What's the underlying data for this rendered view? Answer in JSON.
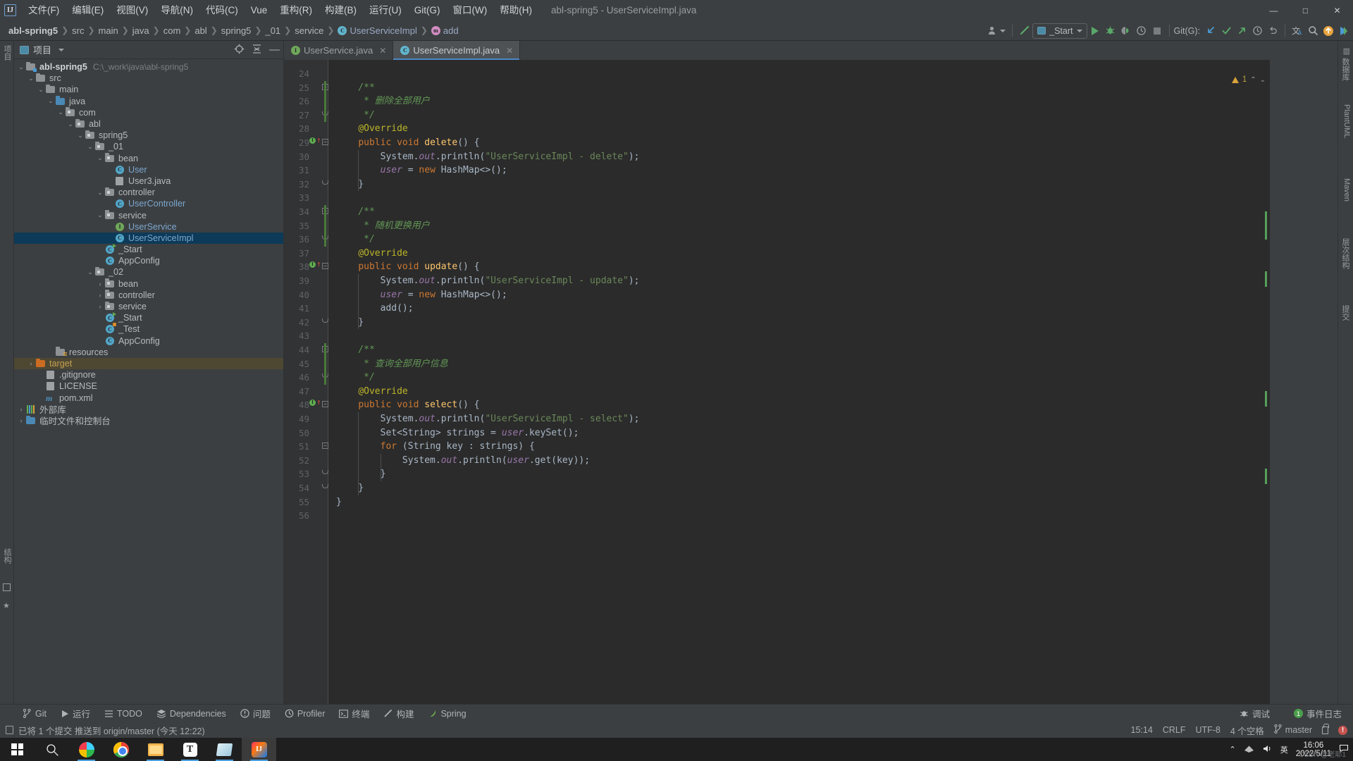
{
  "titlebar": {
    "logo": "IJ",
    "menus": [
      "文件(F)",
      "编辑(E)",
      "视图(V)",
      "导航(N)",
      "代码(C)",
      "Vue",
      "重构(R)",
      "构建(B)",
      "运行(U)",
      "Git(G)",
      "窗口(W)",
      "帮助(H)"
    ],
    "window_title": "abl-spring5 - UserServiceImpl.java",
    "minimize": "—",
    "maximize": "□",
    "close": "✕"
  },
  "navbar": {
    "breadcrumbs": [
      {
        "label": "abl-spring5",
        "style": "bold"
      },
      {
        "label": "src",
        "style": "plain"
      },
      {
        "label": "main",
        "style": "plain"
      },
      {
        "label": "java",
        "style": "plain"
      },
      {
        "label": "com",
        "style": "plain"
      },
      {
        "label": "abl",
        "style": "plain"
      },
      {
        "label": "spring5",
        "style": "plain"
      },
      {
        "label": "_01",
        "style": "plain"
      },
      {
        "label": "service",
        "style": "plain"
      },
      {
        "label": "UserServiceImpl",
        "style": "class"
      },
      {
        "label": "add",
        "style": "method"
      }
    ],
    "separator": "❯",
    "run_config": "_Start",
    "git_label": "Git(G):"
  },
  "left_strip": [
    "项目",
    "结构"
  ],
  "project_panel": {
    "title": "项目",
    "tree": [
      {
        "depth": 0,
        "arrow": "v",
        "icon": "folder-module",
        "label": "abl-spring5",
        "bold": true,
        "sub": "C:\\_work\\java\\abl-spring5"
      },
      {
        "depth": 1,
        "arrow": "v",
        "icon": "folder",
        "label": "src"
      },
      {
        "depth": 2,
        "arrow": "v",
        "icon": "folder",
        "label": "main"
      },
      {
        "depth": 3,
        "arrow": "v",
        "icon": "folder-source",
        "label": "java"
      },
      {
        "depth": 4,
        "arrow": "v",
        "icon": "package",
        "label": "com"
      },
      {
        "depth": 5,
        "arrow": "v",
        "icon": "package",
        "label": "abl"
      },
      {
        "depth": 6,
        "arrow": "v",
        "icon": "package",
        "label": "spring5"
      },
      {
        "depth": 7,
        "arrow": "v",
        "icon": "package",
        "label": "_01"
      },
      {
        "depth": 8,
        "arrow": "v",
        "icon": "package",
        "label": "bean"
      },
      {
        "depth": 9,
        "arrow": "",
        "icon": "class",
        "label": "User",
        "blue": true
      },
      {
        "depth": 9,
        "arrow": "",
        "icon": "file",
        "label": "User3.java"
      },
      {
        "depth": 8,
        "arrow": "v",
        "icon": "package",
        "label": "controller"
      },
      {
        "depth": 9,
        "arrow": "",
        "icon": "class",
        "label": "UserController",
        "blue": true
      },
      {
        "depth": 8,
        "arrow": "v",
        "icon": "package",
        "label": "service"
      },
      {
        "depth": 9,
        "arrow": "",
        "icon": "interface",
        "label": "UserService",
        "blue": true
      },
      {
        "depth": 9,
        "arrow": "",
        "icon": "class",
        "label": "UserServiceImpl",
        "blue": true,
        "selected": true
      },
      {
        "depth": 8,
        "arrow": "",
        "icon": "class-run",
        "label": "_Start"
      },
      {
        "depth": 8,
        "arrow": "",
        "icon": "class",
        "label": "AppConfig"
      },
      {
        "depth": 7,
        "arrow": "v",
        "icon": "package",
        "label": "_02"
      },
      {
        "depth": 8,
        "arrow": ">",
        "icon": "package",
        "label": "bean"
      },
      {
        "depth": 8,
        "arrow": ">",
        "icon": "package",
        "label": "controller"
      },
      {
        "depth": 8,
        "arrow": ">",
        "icon": "package",
        "label": "service"
      },
      {
        "depth": 8,
        "arrow": "",
        "icon": "class-run",
        "label": "_Start"
      },
      {
        "depth": 8,
        "arrow": "",
        "icon": "class-test",
        "label": "_Test"
      },
      {
        "depth": 8,
        "arrow": "",
        "icon": "class",
        "label": "AppConfig"
      },
      {
        "depth": 3,
        "arrow": "",
        "icon": "folder-resources",
        "label": "resources"
      },
      {
        "depth": 1,
        "arrow": ">",
        "icon": "folder-target",
        "label": "target",
        "orange": true,
        "highlight": true
      },
      {
        "depth": 2,
        "arrow": "",
        "icon": "gitignore",
        "label": ".gitignore"
      },
      {
        "depth": 2,
        "arrow": "",
        "icon": "file",
        "label": "LICENSE"
      },
      {
        "depth": 2,
        "arrow": "",
        "icon": "maven",
        "label": "pom.xml"
      },
      {
        "depth": 0,
        "arrow": ">",
        "icon": "library",
        "label": "外部库"
      },
      {
        "depth": 0,
        "arrow": ">",
        "icon": "scratch",
        "label": "临时文件和控制台"
      }
    ]
  },
  "editor": {
    "tabs": [
      {
        "label": "UserService.java",
        "icon": "interface",
        "active": false
      },
      {
        "label": "UserServiceImpl.java",
        "icon": "class",
        "active": true
      }
    ],
    "warning_count": "1",
    "first_line": 24,
    "lines": [
      {
        "n": 24,
        "tokens": []
      },
      {
        "n": 25,
        "fold": "start",
        "change": true,
        "tokens": [
          {
            "t": "    ",
            "c": "pln"
          },
          {
            "t": "/**",
            "c": "cmt"
          }
        ]
      },
      {
        "n": 26,
        "change": true,
        "tokens": [
          {
            "t": "     * ",
            "c": "cmt"
          },
          {
            "t": "删除全部用户",
            "c": "cmt"
          }
        ]
      },
      {
        "n": 27,
        "fold": "end",
        "change": true,
        "tokens": [
          {
            "t": "     */",
            "c": "cmt"
          }
        ]
      },
      {
        "n": 28,
        "tokens": [
          {
            "t": "    ",
            "c": "pln"
          },
          {
            "t": "@Override",
            "c": "ann"
          }
        ]
      },
      {
        "n": 29,
        "override": true,
        "fold": "start",
        "tokens": [
          {
            "t": "    ",
            "c": "pln"
          },
          {
            "t": "public",
            "c": "kw"
          },
          {
            "t": " ",
            "c": "pln"
          },
          {
            "t": "void",
            "c": "kw"
          },
          {
            "t": " ",
            "c": "pln"
          },
          {
            "t": "delete",
            "c": "mth"
          },
          {
            "t": "() {",
            "c": "pln"
          }
        ]
      },
      {
        "n": 30,
        "tokens": [
          {
            "t": "        System.",
            "c": "pln"
          },
          {
            "t": "out",
            "c": "fld"
          },
          {
            "t": ".println(",
            "c": "pln"
          },
          {
            "t": "\"UserServiceImpl - delete\"",
            "c": "str"
          },
          {
            "t": ");",
            "c": "pln"
          }
        ]
      },
      {
        "n": 31,
        "tokens": [
          {
            "t": "        ",
            "c": "pln"
          },
          {
            "t": "user",
            "c": "fld"
          },
          {
            "t": " = ",
            "c": "pln"
          },
          {
            "t": "new",
            "c": "kw"
          },
          {
            "t": " HashMap<>();",
            "c": "pln"
          }
        ]
      },
      {
        "n": 32,
        "fold": "end",
        "tokens": [
          {
            "t": "    }",
            "c": "pln"
          }
        ]
      },
      {
        "n": 33,
        "tokens": []
      },
      {
        "n": 34,
        "fold": "start",
        "change": true,
        "tokens": [
          {
            "t": "    ",
            "c": "pln"
          },
          {
            "t": "/**",
            "c": "cmt"
          }
        ]
      },
      {
        "n": 35,
        "change": true,
        "tokens": [
          {
            "t": "     * ",
            "c": "cmt"
          },
          {
            "t": "随机更换用户",
            "c": "cmt"
          }
        ]
      },
      {
        "n": 36,
        "fold": "end",
        "change": true,
        "tokens": [
          {
            "t": "     */",
            "c": "cmt"
          }
        ]
      },
      {
        "n": 37,
        "tokens": [
          {
            "t": "    ",
            "c": "pln"
          },
          {
            "t": "@Override",
            "c": "ann"
          }
        ]
      },
      {
        "n": 38,
        "override": true,
        "fold": "start",
        "tokens": [
          {
            "t": "    ",
            "c": "pln"
          },
          {
            "t": "public",
            "c": "kw"
          },
          {
            "t": " ",
            "c": "pln"
          },
          {
            "t": "void",
            "c": "kw"
          },
          {
            "t": " ",
            "c": "pln"
          },
          {
            "t": "update",
            "c": "mth"
          },
          {
            "t": "() {",
            "c": "pln"
          }
        ]
      },
      {
        "n": 39,
        "tokens": [
          {
            "t": "        System.",
            "c": "pln"
          },
          {
            "t": "out",
            "c": "fld"
          },
          {
            "t": ".println(",
            "c": "pln"
          },
          {
            "t": "\"UserServiceImpl - update\"",
            "c": "str"
          },
          {
            "t": ");",
            "c": "pln"
          }
        ]
      },
      {
        "n": 40,
        "tokens": [
          {
            "t": "        ",
            "c": "pln"
          },
          {
            "t": "user",
            "c": "fld"
          },
          {
            "t": " = ",
            "c": "pln"
          },
          {
            "t": "new",
            "c": "kw"
          },
          {
            "t": " HashMap<>();",
            "c": "pln"
          }
        ]
      },
      {
        "n": 41,
        "tokens": [
          {
            "t": "        add();",
            "c": "pln"
          }
        ]
      },
      {
        "n": 42,
        "fold": "end",
        "tokens": [
          {
            "t": "    }",
            "c": "pln"
          }
        ]
      },
      {
        "n": 43,
        "tokens": []
      },
      {
        "n": 44,
        "fold": "start",
        "change": true,
        "tokens": [
          {
            "t": "    ",
            "c": "pln"
          },
          {
            "t": "/**",
            "c": "cmt"
          }
        ]
      },
      {
        "n": 45,
        "change": true,
        "tokens": [
          {
            "t": "     * ",
            "c": "cmt"
          },
          {
            "t": "查询全部用户信息",
            "c": "cmt"
          }
        ]
      },
      {
        "n": 46,
        "fold": "end",
        "change": true,
        "tokens": [
          {
            "t": "     */",
            "c": "cmt"
          }
        ]
      },
      {
        "n": 47,
        "tokens": [
          {
            "t": "    ",
            "c": "pln"
          },
          {
            "t": "@Override",
            "c": "ann"
          }
        ]
      },
      {
        "n": 48,
        "override": true,
        "fold": "start",
        "tokens": [
          {
            "t": "    ",
            "c": "pln"
          },
          {
            "t": "public",
            "c": "kw"
          },
          {
            "t": " ",
            "c": "pln"
          },
          {
            "t": "void",
            "c": "kw"
          },
          {
            "t": " ",
            "c": "pln"
          },
          {
            "t": "select",
            "c": "mth"
          },
          {
            "t": "() {",
            "c": "pln"
          }
        ]
      },
      {
        "n": 49,
        "tokens": [
          {
            "t": "        System.",
            "c": "pln"
          },
          {
            "t": "out",
            "c": "fld"
          },
          {
            "t": ".println(",
            "c": "pln"
          },
          {
            "t": "\"UserServiceImpl - select\"",
            "c": "str"
          },
          {
            "t": ");",
            "c": "pln"
          }
        ]
      },
      {
        "n": 50,
        "tokens": [
          {
            "t": "        Set<String> strings = ",
            "c": "pln"
          },
          {
            "t": "user",
            "c": "fld"
          },
          {
            "t": ".keySet();",
            "c": "pln"
          }
        ]
      },
      {
        "n": 51,
        "fold": "start",
        "tokens": [
          {
            "t": "        ",
            "c": "pln"
          },
          {
            "t": "for",
            "c": "kw"
          },
          {
            "t": " (String key : strings) {",
            "c": "pln"
          }
        ]
      },
      {
        "n": 52,
        "tokens": [
          {
            "t": "            System.",
            "c": "pln"
          },
          {
            "t": "out",
            "c": "fld"
          },
          {
            "t": ".println(",
            "c": "pln"
          },
          {
            "t": "user",
            "c": "fld"
          },
          {
            "t": ".get(key));",
            "c": "pln"
          }
        ]
      },
      {
        "n": 53,
        "fold": "end",
        "tokens": [
          {
            "t": "        }",
            "c": "pln"
          }
        ]
      },
      {
        "n": 54,
        "fold": "end",
        "tokens": [
          {
            "t": "    }",
            "c": "pln"
          }
        ]
      },
      {
        "n": 55,
        "tokens": [
          {
            "t": "}",
            "c": "pln"
          }
        ]
      },
      {
        "n": 56,
        "tokens": []
      }
    ]
  },
  "right_strip": [
    "数据库",
    "PlantUML",
    "Maven",
    "层次结构",
    "提交"
  ],
  "bottom_bar": {
    "windows": [
      {
        "label": "Git",
        "icon": "git-icon"
      },
      {
        "label": "运行",
        "icon": "run-icon"
      },
      {
        "label": "TODO",
        "icon": "todo-icon"
      },
      {
        "label": "Dependencies",
        "icon": "dependencies-icon"
      },
      {
        "label": "问题",
        "icon": "problems-icon"
      },
      {
        "label": "Profiler",
        "icon": "profiler-icon"
      },
      {
        "label": "终端",
        "icon": "terminal-icon"
      },
      {
        "label": "构建",
        "icon": "build-icon"
      },
      {
        "label": "Spring",
        "icon": "spring-icon"
      }
    ],
    "right": [
      {
        "label": "调试",
        "icon": "debug-icon"
      },
      {
        "label": "事件日志",
        "icon": "event-log-icon",
        "badge": "1"
      }
    ]
  },
  "statusbar": {
    "message": "已将 1 个提交 推送到 origin/master (今天 12:22)",
    "caret": "15:14",
    "line_sep": "CRLF",
    "encoding": "UTF-8",
    "indent": "4 个空格",
    "branch": "master"
  },
  "taskbar": {
    "items": [
      {
        "name": "start-button",
        "icon": "windows-logo",
        "running": false
      },
      {
        "name": "search",
        "icon": "search-icon",
        "running": false
      },
      {
        "name": "edge",
        "icon": "edge-icon",
        "running": true
      },
      {
        "name": "chrome",
        "icon": "chrome-icon",
        "running": false
      },
      {
        "name": "file-explorer",
        "icon": "folder-icon",
        "running": true
      },
      {
        "name": "typora",
        "icon": "typora-icon",
        "running": true
      },
      {
        "name": "notepad",
        "icon": "note-icon",
        "running": true
      },
      {
        "name": "intellij-idea",
        "icon": "intellij-icon",
        "running": true,
        "active": true
      }
    ],
    "tray": {
      "lang": "英",
      "time": "16:06",
      "date": "2022/5/11"
    }
  },
  "watermark": "CSDN @老耶1",
  "colors": {
    "accent": "#4a88c7",
    "selection": "#0d3a58",
    "editor_bg": "#2b2b2b",
    "panel_bg": "#3c3f41",
    "keyword": "#cc7832",
    "string": "#6a8759",
    "comment": "#629755",
    "annotation": "#bbb529",
    "method": "#ffc66d",
    "field": "#9876aa",
    "text": "#a9b7c6"
  }
}
